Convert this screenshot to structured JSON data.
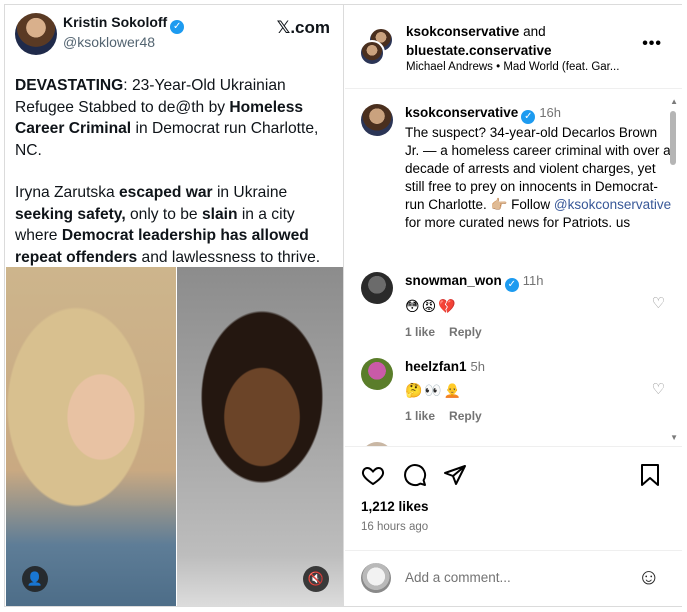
{
  "tweet": {
    "author_name": "Kristin Sokoloff",
    "handle": "@ksoklower48",
    "brand": "𝕏.com",
    "para1": [
      {
        "text": "DEVASTATING",
        "bold": true
      },
      {
        "text": ": 23-Year-Old Ukrainian Refugee Stabbed to de@th by ",
        "bold": false
      },
      {
        "text": "Homeless Career Criminal",
        "bold": true
      },
      {
        "text": " in Democrat run Charlotte, NC.",
        "bold": false
      }
    ],
    "para2": [
      {
        "text": "Iryna Zarutska ",
        "bold": false
      },
      {
        "text": "escaped war",
        "bold": true
      },
      {
        "text": " in Ukraine ",
        "bold": false
      },
      {
        "text": "seeking safety,",
        "bold": true
      },
      {
        "text": " only to be ",
        "bold": false
      },
      {
        "text": "slain",
        "bold": true
      },
      {
        "text": " in a city where ",
        "bold": false
      },
      {
        "text": "Democrat leadership has allowed repeat offenders",
        "bold": true
      },
      {
        "text": " and lawlessness to thrive.",
        "bold": false
      }
    ],
    "user_icon": "👤",
    "mute_icon": "🔇"
  },
  "instagram": {
    "header": {
      "account1": "ksokconservative",
      "joiner": "and",
      "account2": "bluestate.conservative",
      "audio": "Michael Andrews • Mad World (feat. Gar...",
      "more": "•••"
    },
    "caption": {
      "user": "ksokconservative",
      "time": "16h",
      "text_before": "The suspect? 34-year-old Decarlos Brown Jr. — a homeless career criminal with over a decade of arrests and violent charges, yet still free to prey on innocents in Democrat-run Charlotte. 👉🏼 Follow ",
      "mention": "@ksokconservative",
      "text_after": " for more curated news for Patriots. us"
    },
    "comments": [
      {
        "user": "snowman_won",
        "verified": true,
        "time": "11h",
        "emojis": "😳😡💔",
        "likes": "1 like",
        "reply": "Reply"
      },
      {
        "user": "heelzfan1",
        "verified": false,
        "time": "5h",
        "emojis": "🤔👀🧑‍🦲",
        "likes": "1 like",
        "reply": "Reply"
      }
    ],
    "likes_count": "1,212 likes",
    "posted": "16 hours ago",
    "add_placeholder": "Add a comment...",
    "icons": {
      "like": "heart-icon",
      "comment": "comment-icon",
      "share": "share-icon",
      "save": "bookmark-icon"
    }
  }
}
